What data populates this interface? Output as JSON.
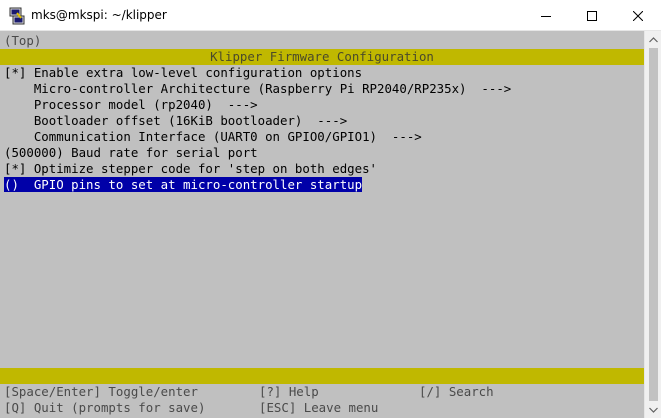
{
  "window": {
    "title": "mks@mkspi: ~/klipper",
    "icon": "putty-icon",
    "minimize_icon": "minimize-icon",
    "maximize_icon": "maximize-icon",
    "close_icon": "close-icon"
  },
  "terminal": {
    "top_label": "(Top)",
    "header": "Klipper Firmware Configuration",
    "menu_items": [
      {
        "text": "[*] Enable extra low-level configuration options",
        "selected": false
      },
      {
        "text": "    Micro-controller Architecture (Raspberry Pi RP2040/RP235x)  --->",
        "selected": false
      },
      {
        "text": "    Processor model (rp2040)  --->",
        "selected": false
      },
      {
        "text": "    Bootloader offset (16KiB bootloader)  --->",
        "selected": false
      },
      {
        "text": "    Communication Interface (UART0 on GPIO0/GPIO1)  --->",
        "selected": false
      },
      {
        "text": "(500000) Baud rate for serial port",
        "selected": false
      },
      {
        "text": "[*] Optimize stepper code for 'step on both edges'",
        "selected": false
      },
      {
        "text": "()  GPIO pins to set at micro-controller startup",
        "selected": true
      }
    ],
    "footer": {
      "row1": [
        "[Space/Enter] Toggle/enter",
        "[?] Help",
        "[/] Search"
      ],
      "row2": [
        "[Q] Quit (prompts for save)",
        "[ESC] Leave menu"
      ]
    },
    "colors": {
      "background": "#c0c0c0",
      "bar": "#c0b800",
      "selection": "#0000a8"
    }
  },
  "scrollbar": {
    "up_icon": "scroll-up-arrow-icon",
    "down_icon": "scroll-down-arrow-icon"
  }
}
